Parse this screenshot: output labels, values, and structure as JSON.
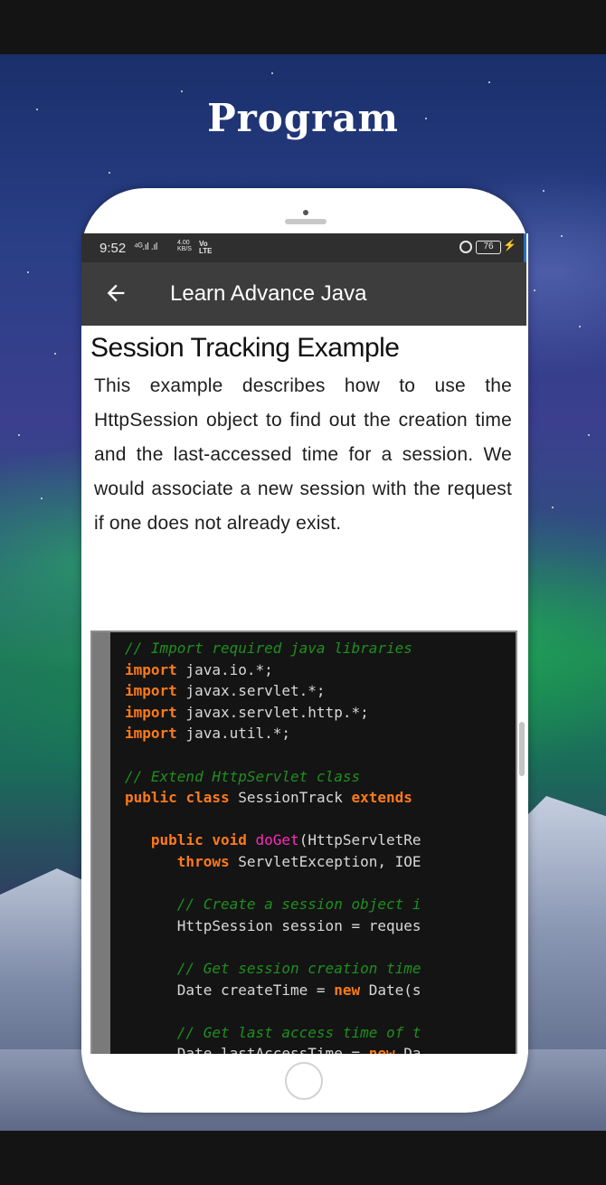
{
  "promo": {
    "title": "Program"
  },
  "status_bar": {
    "time": "9:52",
    "signal": "⁴ᴳ.ıl .ıl",
    "network_speed_value": "4.00",
    "network_speed_unit": "KB/S",
    "volte_top": "Vo",
    "volte_bottom": "LTE",
    "battery": "76"
  },
  "app_bar": {
    "back_icon": "back-arrow-icon",
    "title": "Learn Advance Java"
  },
  "article": {
    "heading": "Session Tracking Example",
    "body": "This example describes how to use the HttpSession object to find out the creation time and the last-accessed time for a session. We would associate a new session with the request if one does not already exist."
  },
  "code": {
    "lines": [
      [
        {
          "t": "// Import required java libraries",
          "c": "comment"
        }
      ],
      [
        {
          "t": "import",
          "c": "keyword"
        },
        {
          "t": " java.io.*;",
          "c": "plain"
        }
      ],
      [
        {
          "t": "import",
          "c": "keyword"
        },
        {
          "t": " javax.servlet.*;",
          "c": "plain"
        }
      ],
      [
        {
          "t": "import",
          "c": "keyword"
        },
        {
          "t": " javax.servlet.http.*;",
          "c": "plain"
        }
      ],
      [
        {
          "t": "import",
          "c": "keyword"
        },
        {
          "t": " java.util.*;",
          "c": "plain"
        }
      ],
      [],
      [
        {
          "t": "// Extend HttpServlet class",
          "c": "comment"
        }
      ],
      [
        {
          "t": "public",
          "c": "keyword"
        },
        {
          "t": " ",
          "c": "plain"
        },
        {
          "t": "class",
          "c": "keyword"
        },
        {
          "t": " SessionTrack ",
          "c": "plain"
        },
        {
          "t": "extends",
          "c": "keyword"
        }
      ],
      [],
      [
        {
          "t": "   ",
          "c": "plain"
        },
        {
          "t": "public",
          "c": "keyword"
        },
        {
          "t": " ",
          "c": "plain"
        },
        {
          "t": "void",
          "c": "keyword"
        },
        {
          "t": " ",
          "c": "plain"
        },
        {
          "t": "doGet",
          "c": "method"
        },
        {
          "t": "(HttpServletRe",
          "c": "plain"
        }
      ],
      [
        {
          "t": "      ",
          "c": "plain"
        },
        {
          "t": "throws",
          "c": "keyword"
        },
        {
          "t": " ServletException, IOE",
          "c": "plain"
        }
      ],
      [],
      [
        {
          "t": "      // Create a session object i",
          "c": "comment"
        }
      ],
      [
        {
          "t": "      HttpSession session = reques",
          "c": "plain"
        }
      ],
      [],
      [
        {
          "t": "      // Get session creation time",
          "c": "comment"
        }
      ],
      [
        {
          "t": "      Date createTime = ",
          "c": "plain"
        },
        {
          "t": "new",
          "c": "keyword"
        },
        {
          "t": " Date(s",
          "c": "plain"
        }
      ],
      [],
      [
        {
          "t": "      // Get last access time of t",
          "c": "comment"
        }
      ],
      [
        {
          "t": "      Date lastAccessTime = ",
          "c": "plain"
        },
        {
          "t": "new",
          "c": "keyword"
        },
        {
          "t": " Da",
          "c": "plain"
        }
      ]
    ]
  }
}
